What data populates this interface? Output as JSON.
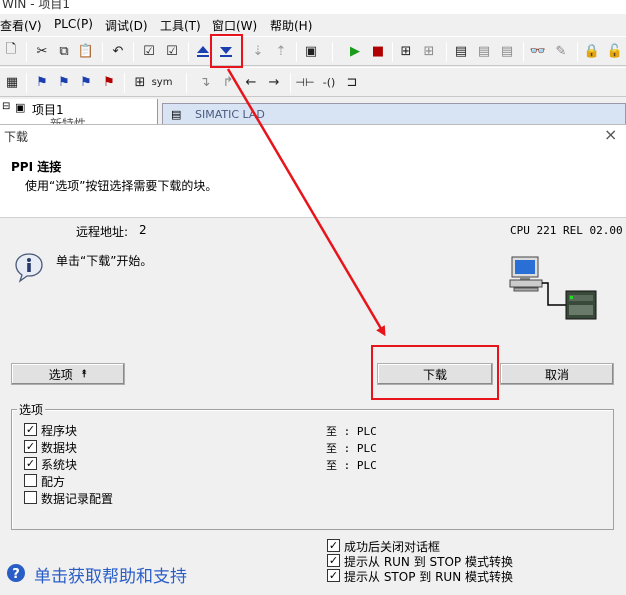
{
  "app": {
    "title": "WIN - 项目1",
    "menu": [
      "查看(V)",
      "PLC(P)",
      "调试(D)",
      "工具(T)",
      "窗口(W)",
      "帮助(H)"
    ],
    "tree_item": "项目1",
    "tree_child": "新特性",
    "doc_tab": "SIMATIC LAD"
  },
  "dialog": {
    "title": "下载",
    "close_glyph": "×",
    "heading": "PPI 连接",
    "subheading": "使用“选项”按钮选择需要下载的块。",
    "remote_address_label": "远程地址:",
    "remote_address_value": "2",
    "cpu_info": "CPU 221 REL 02.00",
    "info_message": "单击“下载”开始。",
    "options_button": "选项",
    "options_arrow": "⯭",
    "download_button": "下载",
    "cancel_button": "取消",
    "options_group_label": "选项",
    "blocks": [
      {
        "label": "程序块",
        "checked": true,
        "target": "至 : PLC"
      },
      {
        "label": "数据块",
        "checked": true,
        "target": "至 : PLC"
      },
      {
        "label": "系统块",
        "checked": true,
        "target": "至 : PLC"
      },
      {
        "label": "配方",
        "checked": false,
        "target": ""
      },
      {
        "label": "数据记录配置",
        "checked": false,
        "target": ""
      }
    ],
    "bottom_options": [
      {
        "label": "成功后关闭对话框",
        "checked": true
      },
      {
        "label": "提示从 RUN 到 STOP 模式转换",
        "checked": true
      },
      {
        "label": "提示从 STOP 到 RUN 模式转换",
        "checked": true
      }
    ],
    "help_link": "单击获取帮助和支持"
  },
  "colors": {
    "highlight_red": "#e8141b",
    "help_blue": "#2a5ec7"
  }
}
